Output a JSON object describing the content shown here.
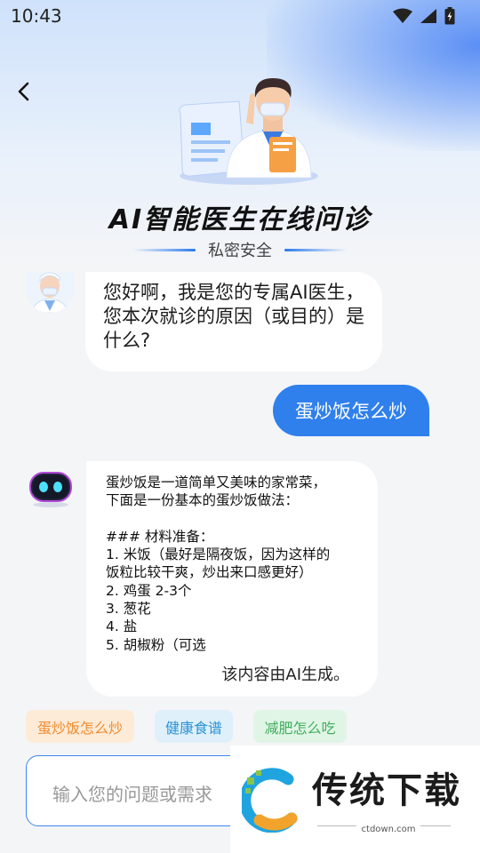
{
  "status": {
    "time": "10:43"
  },
  "header": {
    "title": "AI智能医生在线问诊",
    "subtitle": "私密安全"
  },
  "chat": {
    "greeting": "您好啊，我是您的专属AI医生， 您本次就诊的原因（或目的）是什么?",
    "user_message": "蛋炒饭怎么炒",
    "answer": "蛋炒饭是一道简单又美味的家常菜，\n下面是一份基本的蛋炒饭做法：\n\n### 材料准备：\n1. 米饭（最好是隔夜饭，因为这样的\n饭粒比较干爽，炒出来口感更好）\n2. 鸡蛋 2-3个\n3. 葱花\n4. 盐\n5. 胡椒粉（可选",
    "answer_footer": "该内容由AI生成。"
  },
  "suggestions": [
    {
      "label": "蛋炒饭怎么炒",
      "color": "#f08a2c"
    },
    {
      "label": "健康食谱",
      "color": "#2a92d4"
    },
    {
      "label": "减肥怎么吃",
      "color": "#3fae5c"
    }
  ],
  "input": {
    "placeholder": "输入您的问题或需求"
  },
  "watermark": {
    "brand": "传统下载",
    "url": "ctdown.com"
  },
  "colors": {
    "accent": "#2f80ed",
    "background": "#f4f5f7"
  }
}
